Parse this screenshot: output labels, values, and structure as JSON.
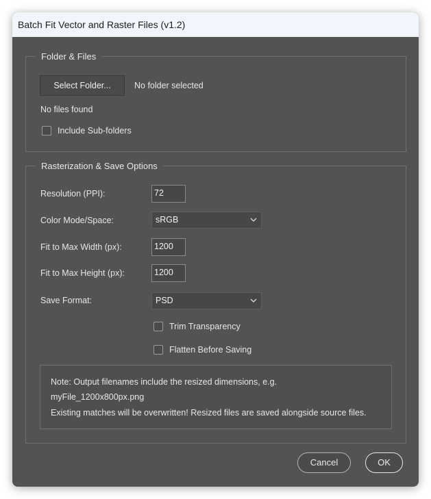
{
  "window": {
    "title": "Batch Fit Vector and Raster Files (v1.2)"
  },
  "folder_panel": {
    "legend": "Folder & Files",
    "select_button": "Select Folder...",
    "folder_status": "No folder selected",
    "files_status": "No files found",
    "include_subfolders_label": "Include Sub-folders",
    "include_subfolders_checked": false
  },
  "options_panel": {
    "legend": "Rasterization & Save Options",
    "resolution_label": "Resolution (PPI):",
    "resolution_value": "72",
    "color_mode_label": "Color Mode/Space:",
    "color_mode_value": "sRGB",
    "max_width_label": "Fit to Max Width (px):",
    "max_width_value": "1200",
    "max_height_label": "Fit to Max Height (px):",
    "max_height_value": "1200",
    "save_format_label": "Save Format:",
    "save_format_value": "PSD",
    "trim_label": "Trim Transparency",
    "trim_checked": false,
    "flatten_label": "Flatten Before Saving",
    "flatten_checked": false,
    "note_line1": "Note: Output filenames include the resized dimensions, e.g.",
    "note_line2": "myFile_1200x800px.png",
    "note_line3": "Existing matches will be overwritten! Resized files are saved alongside source files."
  },
  "footer": {
    "cancel_label": "Cancel",
    "ok_label": "OK"
  },
  "icons": {
    "dropdown": "chevron-down-icon",
    "checkbox": "checkbox-unchecked-icon"
  }
}
